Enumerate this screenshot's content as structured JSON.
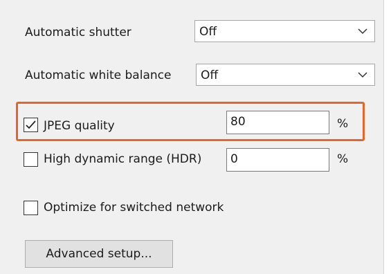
{
  "auto_shutter": {
    "label": "Automatic shutter",
    "value": "Off"
  },
  "auto_white_balance": {
    "label": "Automatic white balance",
    "value": "Off"
  },
  "jpeg_quality": {
    "label": "JPEG quality",
    "checked": true,
    "value": "80",
    "unit": "%"
  },
  "hdr": {
    "label": "High dynamic range (HDR)",
    "checked": false,
    "value": "0",
    "unit": "%"
  },
  "switched_network": {
    "label": "Optimize for switched network",
    "checked": false
  },
  "advanced_button": {
    "label": "Advanced setup..."
  },
  "colors": {
    "highlight": "#e8642b",
    "panel": "#f0f0f0"
  },
  "icons": {
    "combo_arrow": "chevron-down-icon",
    "check": "checkmark-icon"
  }
}
